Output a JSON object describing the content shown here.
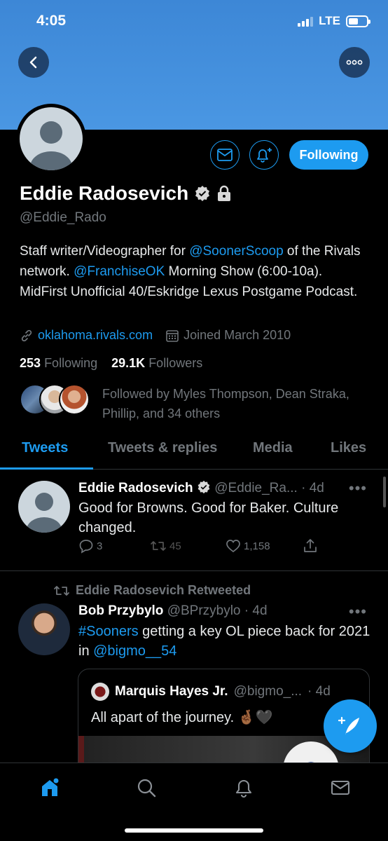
{
  "status_bar": {
    "time": "4:05",
    "network": "LTE"
  },
  "profile": {
    "name": "Eddie Radosevich",
    "handle": "@Eddie_Rado",
    "following_button": "Following",
    "bio": {
      "part1": "Staff writer/Videographer for ",
      "mention1": "@SoonerScoop",
      "part2": " of the Rivals network. ",
      "mention2": "@FranchiseOK",
      "part3": " Morning Show (6:00-10a). MidFirst Unofficial 40/Eskridge Lexus Postgame Podcast."
    },
    "website": "oklahoma.rivals.com",
    "joined": "Joined March 2010",
    "following_count": "253",
    "following_label": "Following",
    "followers_count": "29.1K",
    "followers_label": "Followers",
    "followed_by": "Followed by Myles Thompson, Dean Straka, Phillip, and 34 others"
  },
  "tabs": [
    "Tweets",
    "Tweets & replies",
    "Media",
    "Likes"
  ],
  "tweets": [
    {
      "name": "Eddie Radosevich",
      "handle": "@Eddie_Ra...",
      "time": "· 4d",
      "text": "Good for Browns. Good for Baker. Culture changed.",
      "replies": "3",
      "retweets": "45",
      "likes": "1,158"
    },
    {
      "retweet_label": "Eddie Radosevich Retweeted",
      "name": "Bob Przybylo",
      "handle": "@BPrzybylo",
      "time": "· 4d",
      "hashtag": "#Sooners",
      "text_mid": " getting a key OL piece back for 2021 in ",
      "mention": "@bigmo__54",
      "quote": {
        "name": "Marquis Hayes Jr.",
        "handle": "@bigmo_...",
        "time": "· 4d",
        "text": "All apart of the journey. 🤞🏾🖤"
      }
    }
  ],
  "colors": {
    "accent": "#1d9bf0",
    "banner": "#4a97e3",
    "muted": "#71767b"
  }
}
